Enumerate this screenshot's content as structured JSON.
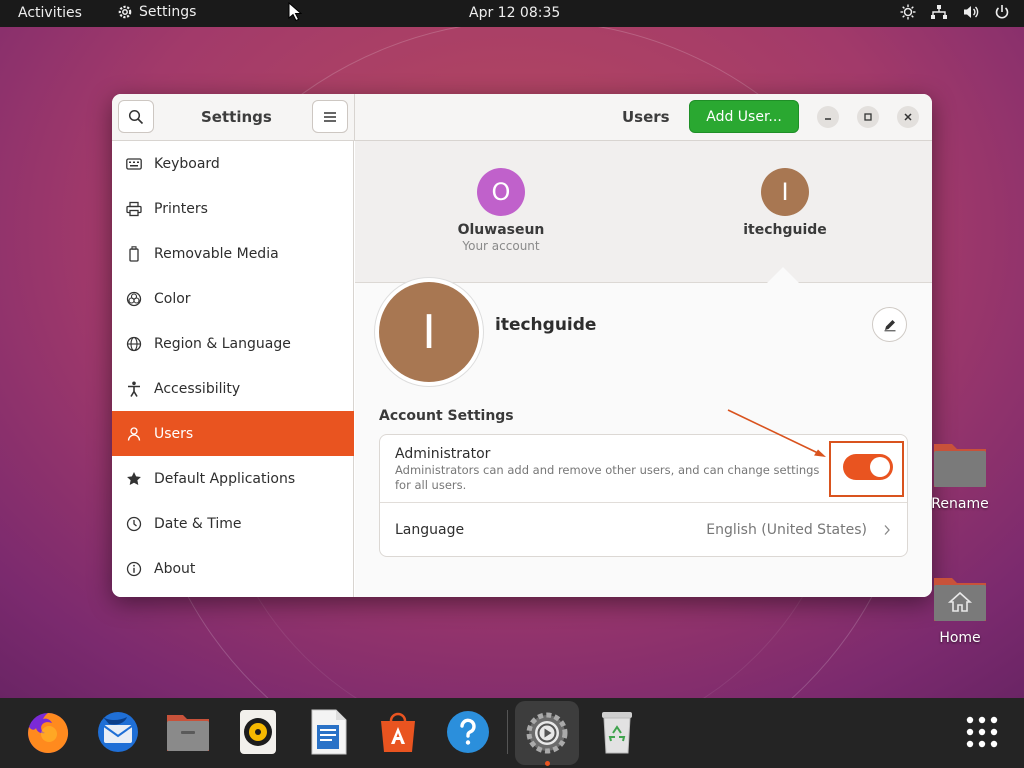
{
  "topbar": {
    "activities": "Activities",
    "app_name": "Settings",
    "clock": "Apr 12  08:35"
  },
  "window": {
    "sidebar_title": "Settings",
    "panel_title": "Users",
    "add_user_label": "Add User..."
  },
  "sidebar": {
    "items": [
      {
        "label": "Keyboard",
        "icon": "keyboard-icon"
      },
      {
        "label": "Printers",
        "icon": "printer-icon"
      },
      {
        "label": "Removable Media",
        "icon": "removable-media-icon"
      },
      {
        "label": "Color",
        "icon": "color-icon"
      },
      {
        "label": "Region & Language",
        "icon": "globe-icon"
      },
      {
        "label": "Accessibility",
        "icon": "accessibility-icon"
      },
      {
        "label": "Users",
        "icon": "users-icon",
        "active": true
      },
      {
        "label": "Default Applications",
        "icon": "star-icon"
      },
      {
        "label": "Date & Time",
        "icon": "clock-icon"
      },
      {
        "label": "About",
        "icon": "info-icon"
      }
    ]
  },
  "users": {
    "accounts": [
      {
        "initial": "O",
        "name": "Oluwaseun",
        "subtitle": "Your account",
        "color": "#c061cb"
      },
      {
        "initial": "I",
        "name": "itechguide",
        "subtitle": "",
        "color": "#a87752"
      }
    ],
    "selected": {
      "initial": "I",
      "name": "itechguide"
    }
  },
  "account_settings": {
    "title": "Account Settings",
    "administrator_label": "Administrator",
    "administrator_desc": "Administrators can add and remove other users, and can change settings for all users.",
    "administrator_enabled": true,
    "language_label": "Language",
    "language_value": "English (United States)"
  },
  "desktop": {
    "rename_label": "Rename",
    "home_label": "Home"
  },
  "dock": {
    "apps": [
      "firefox-icon",
      "thunderbird-icon",
      "files-icon",
      "rhythmbox-icon",
      "libreoffice-writer-icon",
      "software-icon",
      "help-icon",
      "settings-icon",
      "trash-icon",
      "show-apps-icon"
    ]
  },
  "colors": {
    "accent": "#e95420",
    "add_button": "#2aa831"
  }
}
